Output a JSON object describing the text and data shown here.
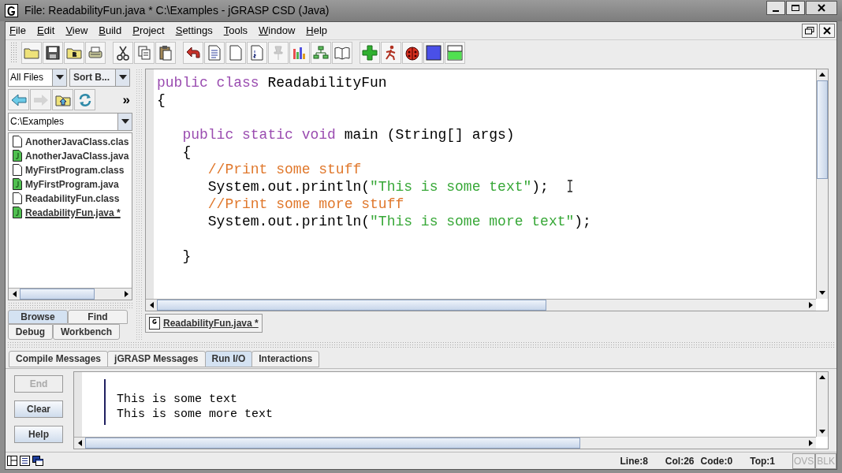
{
  "window": {
    "title": "File: ReadabilityFun.java *  C:\\Examples - jGRASP CSD (Java)"
  },
  "menu": [
    "File",
    "Edit",
    "View",
    "Build",
    "Project",
    "Settings",
    "Tools",
    "Window",
    "Help"
  ],
  "browser": {
    "filter": "All Files",
    "sort": "Sort B...",
    "more": "»",
    "path": "C:\\Examples",
    "files": [
      {
        "name": "AnotherJavaClass.clas",
        "kind": "class",
        "open": false
      },
      {
        "name": "AnotherJavaClass.java",
        "kind": "java",
        "open": false
      },
      {
        "name": "MyFirstProgram.class",
        "kind": "class",
        "open": false
      },
      {
        "name": "MyFirstProgram.java",
        "kind": "java",
        "open": false
      },
      {
        "name": "ReadabilityFun.class",
        "kind": "class",
        "open": false
      },
      {
        "name": "ReadabilityFun.java *",
        "kind": "java",
        "open": true
      }
    ],
    "tabs_top": [
      {
        "label": "Browse",
        "selected": true
      },
      {
        "label": "Find",
        "selected": false
      }
    ],
    "tabs_bottom": [
      {
        "label": "Debug",
        "selected": false
      },
      {
        "label": "Workbench",
        "selected": false
      }
    ]
  },
  "editor": {
    "lines": [
      {
        "kind": "code",
        "tokens": [
          {
            "kind": "keyword",
            "text": "public class "
          },
          {
            "kind": "plain",
            "text": "ReadabilityFun"
          }
        ]
      },
      {
        "kind": "code",
        "tokens": [
          {
            "kind": "plain",
            "text": "{"
          }
        ]
      },
      {
        "kind": "blank"
      },
      {
        "kind": "code",
        "tokens": [
          {
            "kind": "keyword",
            "text": "   public static void "
          },
          {
            "kind": "plain",
            "text": "main (String[] args)"
          }
        ]
      },
      {
        "kind": "code",
        "tokens": [
          {
            "kind": "plain",
            "text": "   {"
          }
        ]
      },
      {
        "kind": "code",
        "tokens": [
          {
            "kind": "comment",
            "text": "      //Print some stuff"
          }
        ]
      },
      {
        "kind": "code",
        "tokens": [
          {
            "kind": "plain",
            "text": "      System.out.println("
          },
          {
            "kind": "string",
            "text": "\"This is some text\""
          },
          {
            "kind": "plain",
            "text": ");"
          }
        ]
      },
      {
        "kind": "code",
        "tokens": [
          {
            "kind": "comment",
            "text": "      //Print some more stuff"
          }
        ]
      },
      {
        "kind": "code",
        "tokens": [
          {
            "kind": "plain",
            "text": "      System.out.println("
          },
          {
            "kind": "string",
            "text": "\"This is some more text\""
          },
          {
            "kind": "plain",
            "text": ");"
          }
        ]
      },
      {
        "kind": "blank"
      },
      {
        "kind": "code",
        "tokens": [
          {
            "kind": "plain",
            "text": "   }"
          }
        ]
      }
    ],
    "tab": "ReadabilityFun.java *"
  },
  "messages": {
    "tabs": [
      {
        "label": "Compile Messages",
        "selected": false
      },
      {
        "label": "jGRASP Messages",
        "selected": false
      },
      {
        "label": "Run I/O",
        "selected": true
      },
      {
        "label": "Interactions",
        "selected": false
      }
    ],
    "buttons": [
      {
        "label": "End",
        "disabled": true
      },
      {
        "label": "Clear",
        "disabled": false
      },
      {
        "label": "Help",
        "disabled": false
      }
    ],
    "output": [
      "This is some text",
      "This is some more text"
    ]
  },
  "status": {
    "line": "Line:8",
    "col": "Col:26",
    "code": "Code:0",
    "top": "Top:1",
    "ovs": "OVS",
    "blk": "BLK"
  }
}
